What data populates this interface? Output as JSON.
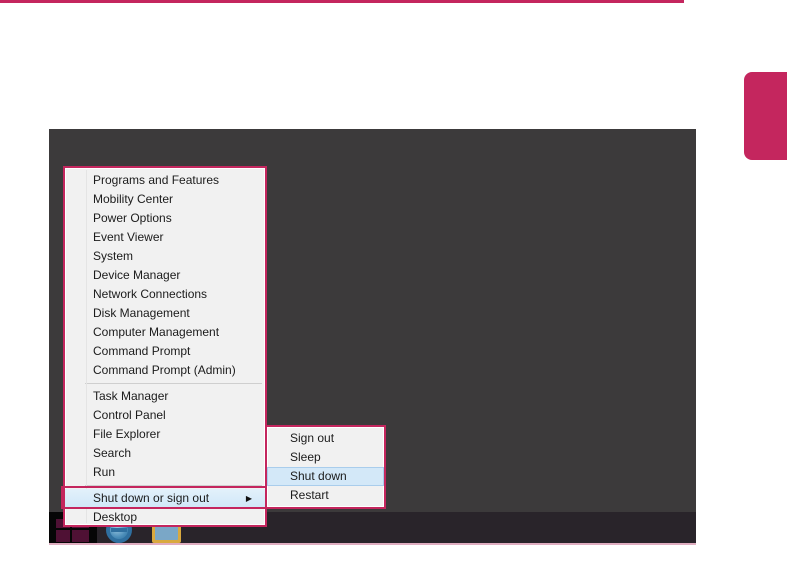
{
  "colors": {
    "accent": "#c4265e",
    "desktop_background": "#3c3a3b",
    "taskbar_background": "#29242a",
    "menu_background": "#f1f1f1",
    "menu_text": "#1b1b1b",
    "selection_blue": "#d3e8f8",
    "screenshot_bottom_edge": "#dfadc0"
  },
  "winx_menu": {
    "items": [
      {
        "label": "Programs and Features"
      },
      {
        "label": "Mobility Center"
      },
      {
        "label": "Power Options"
      },
      {
        "label": "Event Viewer"
      },
      {
        "label": "System"
      },
      {
        "label": "Device Manager"
      },
      {
        "label": "Network Connections"
      },
      {
        "label": "Disk Management"
      },
      {
        "label": "Computer Management"
      },
      {
        "label": "Command Prompt"
      },
      {
        "label": "Command Prompt (Admin)",
        "separator_after": true
      },
      {
        "label": "Task Manager"
      },
      {
        "label": "Control Panel"
      },
      {
        "label": "File Explorer"
      },
      {
        "label": "Search"
      },
      {
        "label": "Run",
        "separator_after": true
      },
      {
        "label": "Shut down or sign out",
        "highlighted": true,
        "has_submenu_arrow": true,
        "annotated": true
      },
      {
        "label": "Desktop"
      }
    ],
    "submenu_arrow_glyph": "▶"
  },
  "shutdown_submenu": {
    "items": [
      {
        "label": "Sign out"
      },
      {
        "label": "Sleep"
      },
      {
        "label": "Shut down",
        "highlighted": true
      },
      {
        "label": "Restart"
      }
    ]
  },
  "taskbar": {
    "icons": [
      {
        "name": "start-button",
        "icon": "windows-logo-icon"
      },
      {
        "name": "internet-explorer-taskbar-item",
        "icon": "internet-explorer-icon"
      },
      {
        "name": "file-explorer-taskbar-item",
        "icon": "folder-icon"
      }
    ]
  }
}
